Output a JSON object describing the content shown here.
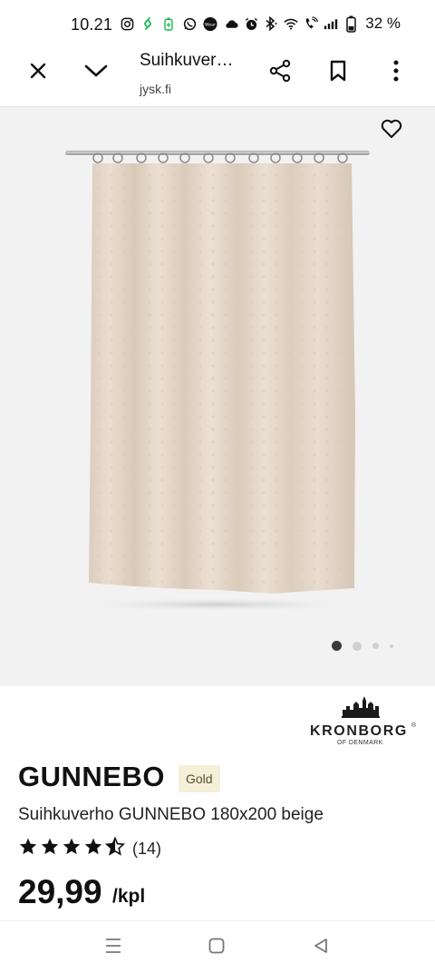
{
  "status_bar": {
    "time": "10.21",
    "battery": "32 %",
    "left_icons": [
      "instagram-icon",
      "shazam-icon",
      "battery-saver-icon",
      "whatsapp-icon",
      "wear-icon",
      "cloud-icon"
    ],
    "right_icons": [
      "alarm-icon",
      "bluetooth-icon",
      "wifi-icon",
      "wifi-calling-icon",
      "signal-icon",
      "battery-icon"
    ]
  },
  "toolbar": {
    "title": "Suihkuver…",
    "url": "jysk.fi",
    "icons": [
      "close-icon",
      "chevron-down-icon",
      "share-icon",
      "bookmark-icon",
      "more-vertical-icon"
    ]
  },
  "gallery": {
    "image": "shower-curtain-image",
    "favorite_icon": "heart-icon",
    "page_count": 4,
    "active_page": 1
  },
  "brand": {
    "name": "KRONBORG",
    "sub": "OF DENMARK",
    "registered": "®"
  },
  "product": {
    "name": "GUNNEBO",
    "badge": "Gold",
    "description": "Suihkuverho GUNNEBO 180x200 beige",
    "rating": 4.5,
    "rating_count": "(14)",
    "price": "29,99",
    "unit": "/kpl"
  },
  "nav": {
    "icons": [
      "recent-apps-icon",
      "home-icon",
      "back-icon"
    ]
  },
  "colors": {
    "gallery_bg": "#f2f2f2",
    "curtain": "#e6d9cb",
    "badge_bg": "#f4efd9",
    "text": "#111111"
  }
}
